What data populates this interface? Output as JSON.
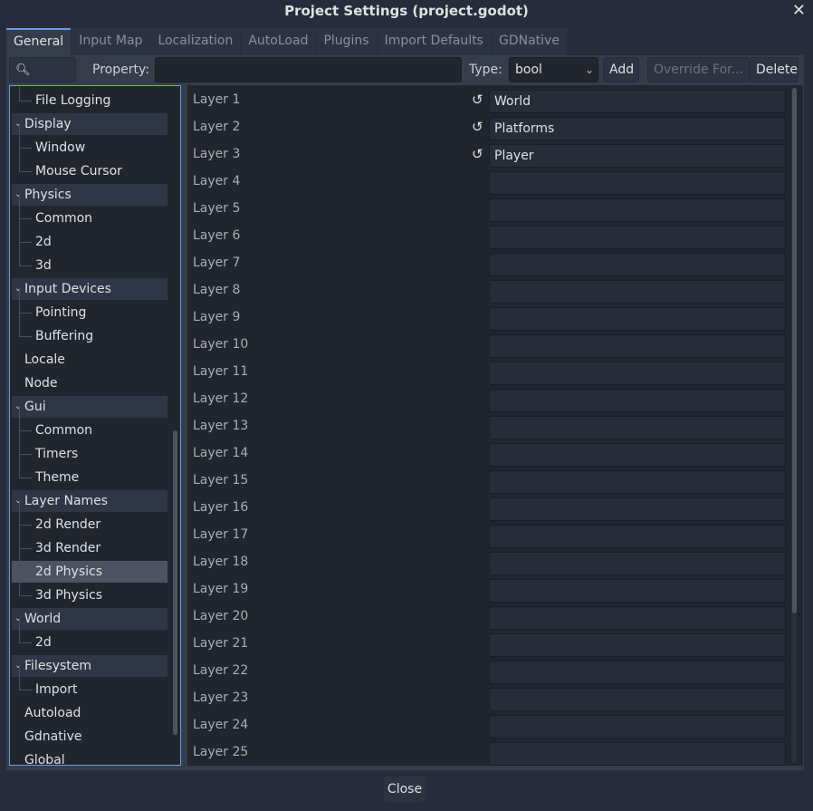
{
  "window": {
    "title": "Project Settings (project.godot)",
    "close_icon": "close-icon"
  },
  "tabs": [
    {
      "label": "General",
      "active": true
    },
    {
      "label": "Input Map",
      "active": false
    },
    {
      "label": "Localization",
      "active": false
    },
    {
      "label": "AutoLoad",
      "active": false
    },
    {
      "label": "Plugins",
      "active": false
    },
    {
      "label": "Import Defaults",
      "active": false
    },
    {
      "label": "GDNative",
      "active": false
    }
  ],
  "toolbar": {
    "search_label": "Search",
    "search_icon": "magnifier-icon",
    "property_label": "Property:",
    "property_value": "",
    "type_label": "Type:",
    "type_value": "bool",
    "add_label": "Add",
    "override_label": "Override For...",
    "delete_label": "Delete"
  },
  "tree": {
    "items": [
      {
        "label": "File Logging",
        "level": 1,
        "kind": "child"
      },
      {
        "label": "Display",
        "level": 0,
        "kind": "section"
      },
      {
        "label": "Window",
        "level": 1,
        "kind": "child"
      },
      {
        "label": "Mouse Cursor",
        "level": 1,
        "kind": "child"
      },
      {
        "label": "Physics",
        "level": 0,
        "kind": "section"
      },
      {
        "label": "Common",
        "level": 1,
        "kind": "child"
      },
      {
        "label": "2d",
        "level": 1,
        "kind": "child"
      },
      {
        "label": "3d",
        "level": 1,
        "kind": "child"
      },
      {
        "label": "Input Devices",
        "level": 0,
        "kind": "section"
      },
      {
        "label": "Pointing",
        "level": 1,
        "kind": "child"
      },
      {
        "label": "Buffering",
        "level": 1,
        "kind": "child"
      },
      {
        "label": "Locale",
        "level": 0,
        "kind": "leaf"
      },
      {
        "label": "Node",
        "level": 0,
        "kind": "leaf"
      },
      {
        "label": "Gui",
        "level": 0,
        "kind": "section"
      },
      {
        "label": "Common",
        "level": 1,
        "kind": "child"
      },
      {
        "label": "Timers",
        "level": 1,
        "kind": "child"
      },
      {
        "label": "Theme",
        "level": 1,
        "kind": "child"
      },
      {
        "label": "Layer Names",
        "level": 0,
        "kind": "section"
      },
      {
        "label": "2d Render",
        "level": 1,
        "kind": "child"
      },
      {
        "label": "3d Render",
        "level": 1,
        "kind": "child"
      },
      {
        "label": "2d Physics",
        "level": 1,
        "kind": "child",
        "selected": true
      },
      {
        "label": "3d Physics",
        "level": 1,
        "kind": "child"
      },
      {
        "label": "World",
        "level": 0,
        "kind": "section"
      },
      {
        "label": "2d",
        "level": 1,
        "kind": "child"
      },
      {
        "label": "Filesystem",
        "level": 0,
        "kind": "section"
      },
      {
        "label": "Import",
        "level": 1,
        "kind": "child"
      },
      {
        "label": "Autoload",
        "level": 0,
        "kind": "leaf"
      },
      {
        "label": "Gdnative",
        "level": 0,
        "kind": "leaf"
      },
      {
        "label": "Global",
        "level": 0,
        "kind": "leaf"
      }
    ]
  },
  "properties": [
    {
      "name": "Layer 1",
      "value": "World",
      "revertable": true
    },
    {
      "name": "Layer 2",
      "value": "Platforms",
      "revertable": true
    },
    {
      "name": "Layer 3",
      "value": "Player",
      "revertable": true
    },
    {
      "name": "Layer 4",
      "value": "",
      "revertable": false
    },
    {
      "name": "Layer 5",
      "value": "",
      "revertable": false
    },
    {
      "name": "Layer 6",
      "value": "",
      "revertable": false
    },
    {
      "name": "Layer 7",
      "value": "",
      "revertable": false
    },
    {
      "name": "Layer 8",
      "value": "",
      "revertable": false
    },
    {
      "name": "Layer 9",
      "value": "",
      "revertable": false
    },
    {
      "name": "Layer 10",
      "value": "",
      "revertable": false
    },
    {
      "name": "Layer 11",
      "value": "",
      "revertable": false
    },
    {
      "name": "Layer 12",
      "value": "",
      "revertable": false
    },
    {
      "name": "Layer 13",
      "value": "",
      "revertable": false
    },
    {
      "name": "Layer 14",
      "value": "",
      "revertable": false
    },
    {
      "name": "Layer 15",
      "value": "",
      "revertable": false
    },
    {
      "name": "Layer 16",
      "value": "",
      "revertable": false
    },
    {
      "name": "Layer 17",
      "value": "",
      "revertable": false
    },
    {
      "name": "Layer 18",
      "value": "",
      "revertable": false
    },
    {
      "name": "Layer 19",
      "value": "",
      "revertable": false
    },
    {
      "name": "Layer 20",
      "value": "",
      "revertable": false
    },
    {
      "name": "Layer 21",
      "value": "",
      "revertable": false
    },
    {
      "name": "Layer 22",
      "value": "",
      "revertable": false
    },
    {
      "name": "Layer 23",
      "value": "",
      "revertable": false
    },
    {
      "name": "Layer 24",
      "value": "",
      "revertable": false
    },
    {
      "name": "Layer 25",
      "value": "",
      "revertable": false
    }
  ],
  "footer": {
    "close_label": "Close"
  }
}
